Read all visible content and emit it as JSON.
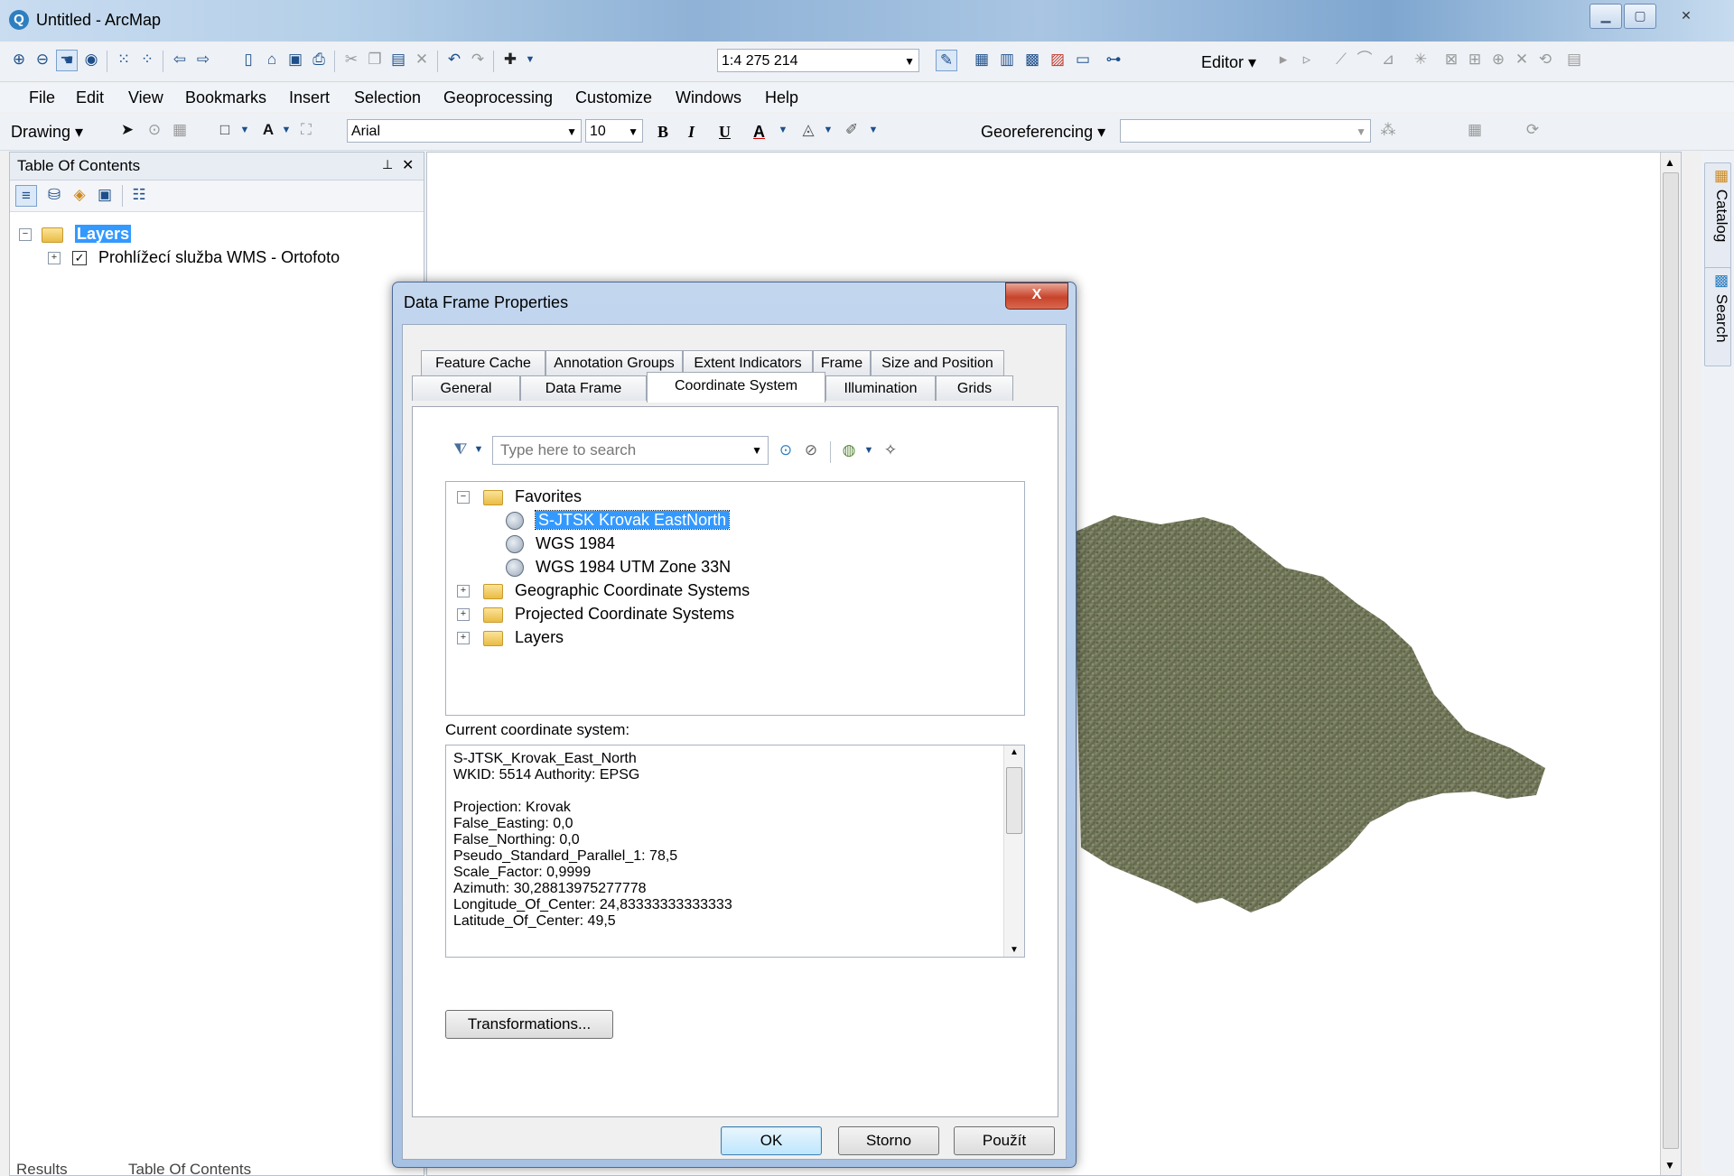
{
  "window": {
    "title": "Untitled - ArcMap"
  },
  "toolbar": {
    "scale": "1:4 275 214",
    "editor_label": "Editor",
    "drawing_label": "Drawing",
    "font_name": "Arial",
    "font_size": "10",
    "bold": "B",
    "italic": "I",
    "underline": "U",
    "font_color": "A",
    "georef_label": "Georeferencing"
  },
  "menu": [
    "File",
    "Edit",
    "View",
    "Bookmarks",
    "Insert",
    "Selection",
    "Geoprocessing",
    "Customize",
    "Windows",
    "Help"
  ],
  "toc": {
    "title": "Table Of Contents",
    "pin": "⊥",
    "close": "✕",
    "root_label": "Layers",
    "layer_label": "Prohlížecí služba WMS - Ortofoto"
  },
  "side_tabs": {
    "catalog": "Catalog",
    "search": "Search"
  },
  "dialog": {
    "title": "Data Frame Properties",
    "close": "X",
    "tabs_row1": [
      "Feature Cache",
      "Annotation Groups",
      "Extent Indicators",
      "Frame",
      "Size and Position"
    ],
    "tabs_row2": [
      "General",
      "Data Frame",
      "Coordinate System",
      "Illumination",
      "Grids"
    ],
    "search_placeholder": "Type here to search",
    "tree": {
      "favorites": "Favorites",
      "fav_items": [
        "S-JTSK Krovak EastNorth",
        "WGS 1984",
        "WGS 1984 UTM Zone 33N"
      ],
      "folders": [
        "Geographic Coordinate Systems",
        "Projected Coordinate Systems",
        "Layers"
      ]
    },
    "current_label": "Current coordinate system:",
    "current_lines": [
      "S-JTSK_Krovak_East_North",
      "WKID: 5514 Authority: EPSG",
      "",
      "Projection: Krovak",
      "False_Easting: 0,0",
      "False_Northing: 0,0",
      "Pseudo_Standard_Parallel_1: 78,5",
      "Scale_Factor: 0,9999",
      "Azimuth: 30,28813975277778",
      "Longitude_Of_Center: 24,83333333333333",
      "Latitude_Of_Center: 49,5"
    ],
    "transformations_btn": "Transformations...",
    "ok_btn": "OK",
    "cancel_btn": "Storno",
    "apply_btn": "Použít"
  },
  "bottom_tabs": {
    "results": "Results",
    "toc": "Table Of Contents"
  }
}
